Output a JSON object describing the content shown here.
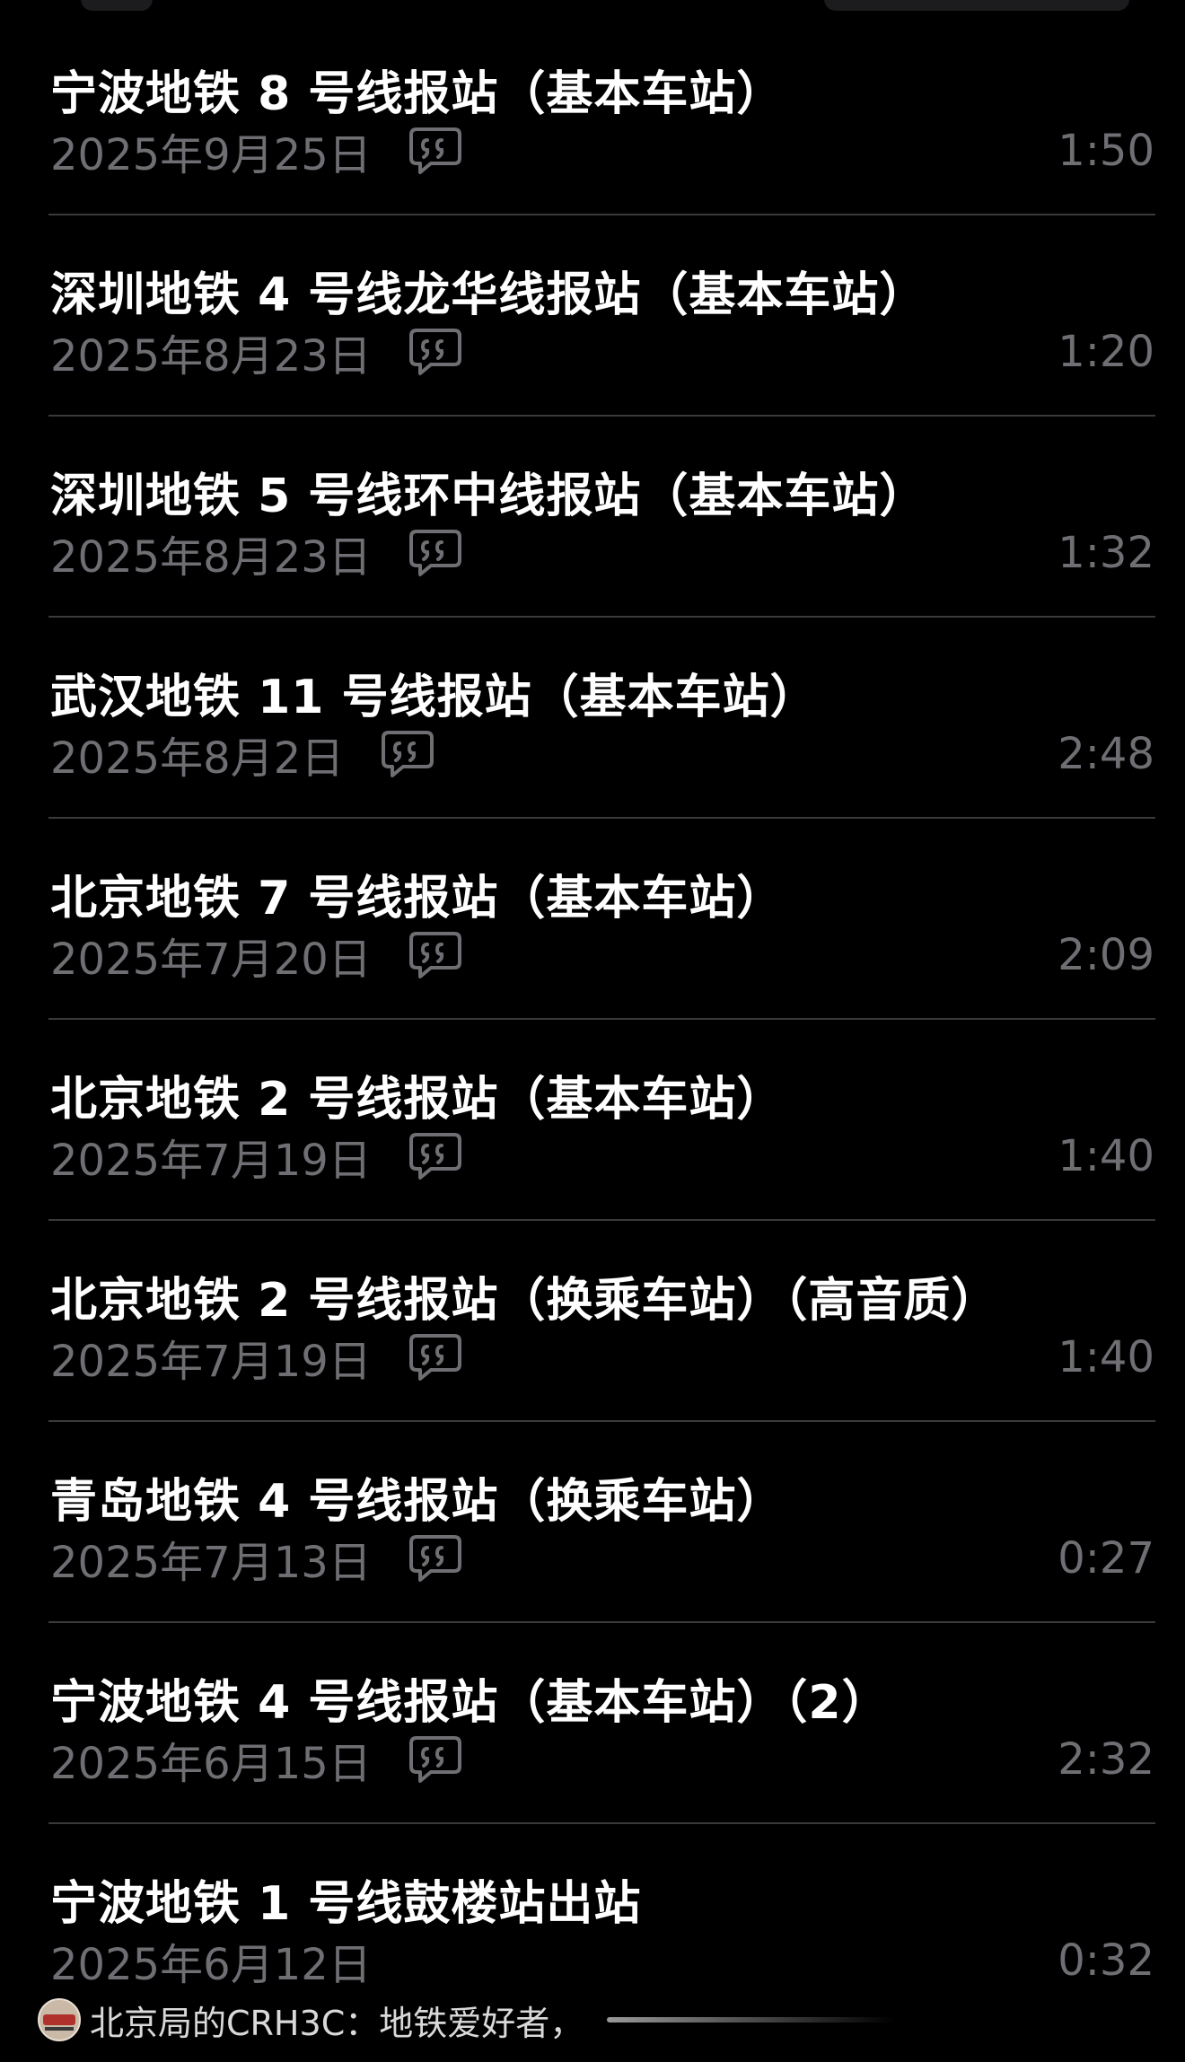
{
  "colors": {
    "background": "#000000",
    "title": "#ffffff",
    "secondary": "#6e6e73",
    "divider": "#3a3a3c"
  },
  "recordings": [
    {
      "title": "宁波地铁 8 号线报站（基本车站）",
      "date": "2025年9月25日",
      "duration": "1:50",
      "icon": "transcript-icon"
    },
    {
      "title": "深圳地铁 4 号线龙华线报站（基本车站）",
      "date": "2025年8月23日",
      "duration": "1:20",
      "icon": "transcript-icon"
    },
    {
      "title": "深圳地铁 5 号线环中线报站（基本车站）",
      "date": "2025年8月23日",
      "duration": "1:32",
      "icon": "transcript-icon"
    },
    {
      "title": "武汉地铁 11 号线报站（基本车站）",
      "date": "2025年8月2日",
      "duration": "2:48",
      "icon": "transcript-icon"
    },
    {
      "title": "北京地铁 7 号线报站（基本车站）",
      "date": "2025年7月20日",
      "duration": "2:09",
      "icon": "transcript-icon"
    },
    {
      "title": "北京地铁 2 号线报站（基本车站）",
      "date": "2025年7月19日",
      "duration": "1:40",
      "icon": "transcript-icon"
    },
    {
      "title": "北京地铁 2 号线报站（换乘车站）（高音质）",
      "date": "2025年7月19日",
      "duration": "1:40",
      "icon": "transcript-icon"
    },
    {
      "title": "青岛地铁 4 号线报站（换乘车站）",
      "date": "2025年7月13日",
      "duration": "0:27",
      "icon": "transcript-icon"
    },
    {
      "title": "宁波地铁 4 号线报站（基本车站）（2）",
      "date": "2025年6月15日",
      "duration": "2:32",
      "icon": "transcript-icon"
    },
    {
      "title": "宁波地铁 1 号线鼓楼站出站",
      "date": "2025年6月12日",
      "duration": "0:32",
      "icon": ""
    }
  ],
  "watermark": {
    "text": "北京局的CRH3C：地铁爱好者，",
    "avatar_icon": "avatar-train-icon"
  }
}
